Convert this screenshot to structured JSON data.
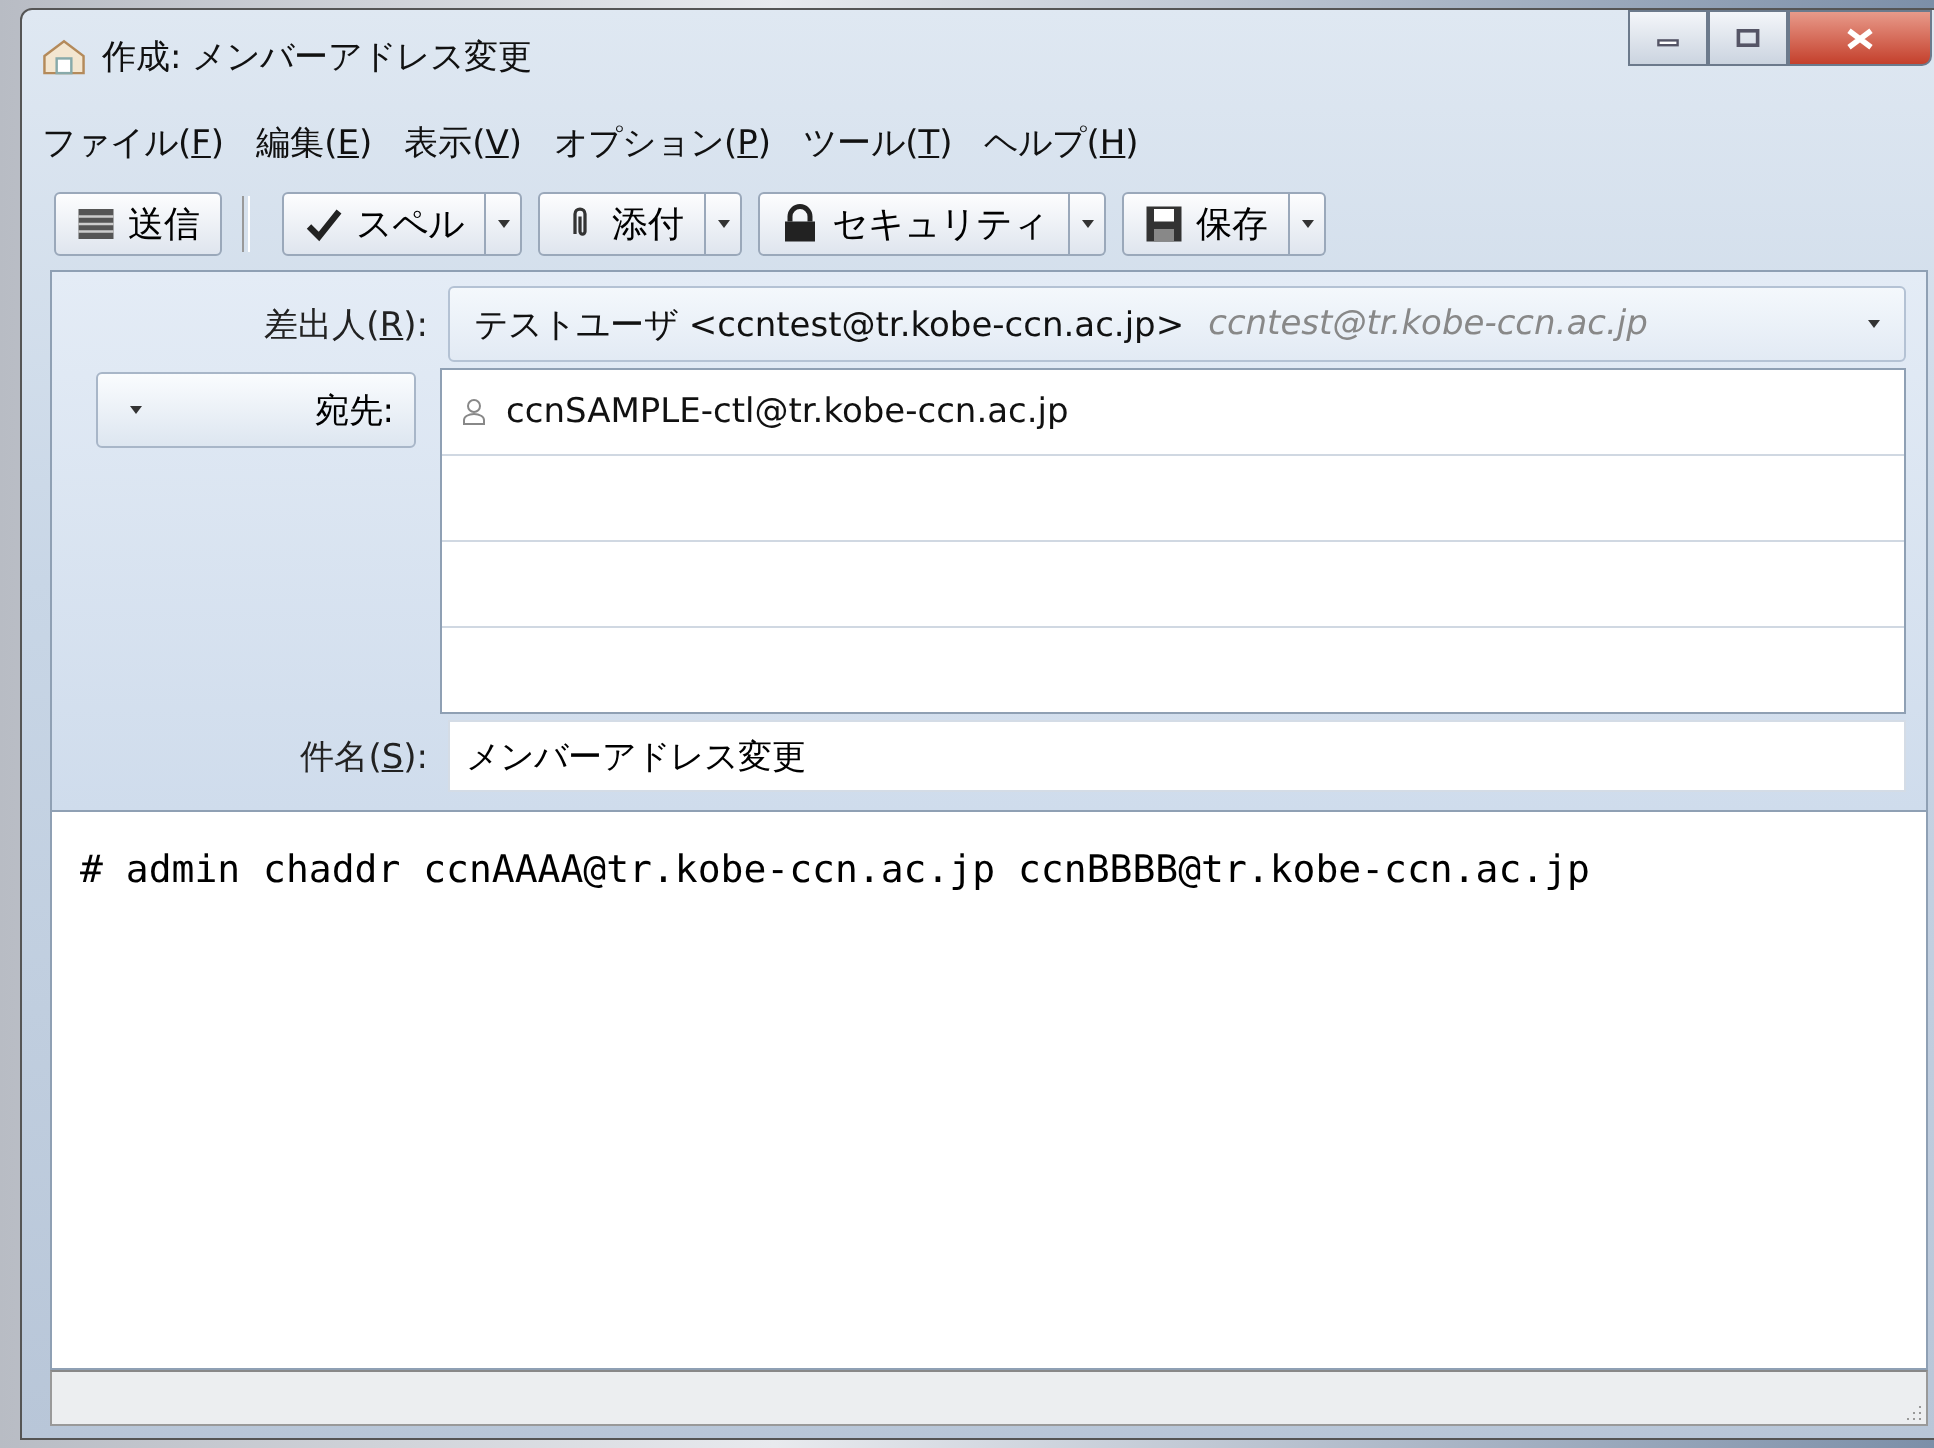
{
  "window": {
    "title": "作成: メンバーアドレス変更"
  },
  "menu": [
    "ファイル(F)",
    "編集(E)",
    "表示(V)",
    "オプション(P)",
    "ツール(T)",
    "ヘルプ(H)"
  ],
  "toolbar": [
    {
      "kind": "send",
      "label": "送信",
      "dropdown": false
    },
    {
      "kind": "spell",
      "label": "スペル",
      "dropdown": true
    },
    {
      "kind": "attach",
      "label": "添付",
      "dropdown": true
    },
    {
      "kind": "security",
      "label": "セキュリティ",
      "dropdown": true
    },
    {
      "kind": "save",
      "label": "保存",
      "dropdown": true
    }
  ],
  "from": {
    "label": "差出人(R):",
    "name": "テストユーザ <ccntest@tr.kobe-ccn.ac.jp>",
    "identity": "ccntest@tr.kobe-ccn.ac.jp"
  },
  "to": {
    "label": "宛先:",
    "recipients": [
      "ccnSAMPLE-ctl@tr.kobe-ccn.ac.jp"
    ]
  },
  "subject": {
    "label": "件名(S):",
    "value": "メンバーアドレス変更"
  },
  "body": "# admin chaddr ccnAAAA@tr.kobe-ccn.ac.jp ccnBBBB@tr.kobe-ccn.ac.jp"
}
